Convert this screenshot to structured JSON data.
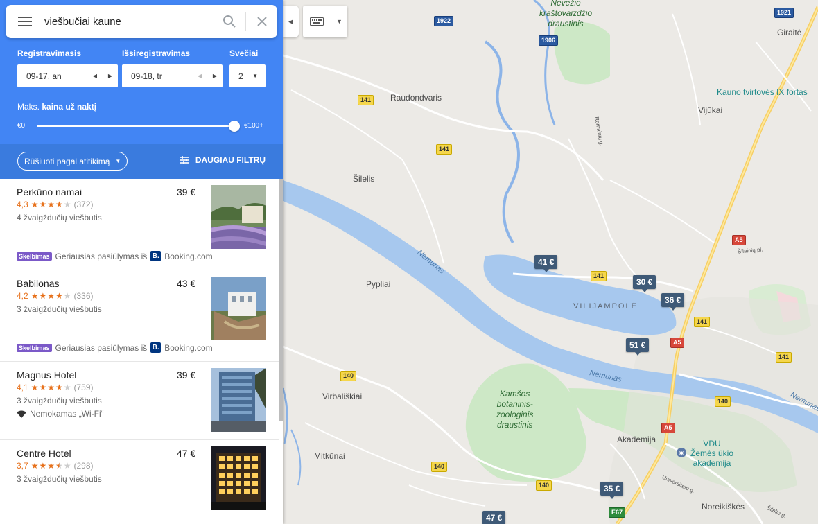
{
  "search": {
    "query": "viešbučiai kaune"
  },
  "filters": {
    "checkin_label": "Registravimasis",
    "checkin_value": "09-17, an",
    "checkout_label": "Išsiregistravimas",
    "checkout_value": "09-18, tr",
    "guests_label": "Svečiai",
    "guests_value": "2",
    "price_label_prefix": "Maks.",
    "price_label_bold": "kaina už naktį",
    "price_min": "€0",
    "price_max": "€100+",
    "price_slider_fraction": 1.0
  },
  "sort": {
    "label": "Rūšiuoti pagal atitikimą",
    "more_filters": "DAUGIAU FILTRŲ"
  },
  "hotels": [
    {
      "name": "Perkūno namai",
      "price": "39 €",
      "rating": "4,3",
      "stars": 4.3,
      "reviews": "(372)",
      "class": "4 žvaigždučių viešbutis",
      "ad": "Skelbimas",
      "ad_text": "Geriausias pasiūlymas iš",
      "ad_provider": "Booking.com",
      "booking_letter": "B."
    },
    {
      "name": "Babilonas",
      "price": "43 €",
      "rating": "4,2",
      "stars": 4.2,
      "reviews": "(336)",
      "class": "3 žvaigždučių viešbutis",
      "ad": "Skelbimas",
      "ad_text": "Geriausias pasiūlymas iš",
      "ad_provider": "Booking.com",
      "booking_letter": "B."
    },
    {
      "name": "Magnus Hotel",
      "price": "39 €",
      "rating": "4,1",
      "stars": 4.1,
      "reviews": "(759)",
      "class": "3 žvaigždučių viešbutis",
      "amenity": "Nemokamas „Wi-Fi“"
    },
    {
      "name": "Centre Hotel",
      "price": "47 €",
      "rating": "3,7",
      "stars": 3.7,
      "reviews": "(298)",
      "class": "3 žvaigždučių viešbutis"
    }
  ],
  "map": {
    "places": {
      "raudondvaris": "Raudondvaris",
      "vijukai": "Vijūkai",
      "giraite": "Giraitė",
      "kauno_fort": "Kauno tvirtovės IX fortas",
      "silelis": "Šilelis",
      "pypliai": "Pypliai",
      "vilijampole": "VILIJAMPOLĖ",
      "virbaliskiai": "Virbališkiai",
      "mitkunai": "Mitkūnai",
      "akademija": "Akademija",
      "vdu1": "VDU",
      "vdu2": "Žemės ūkio",
      "vdu3": "akademija",
      "noreikiskes": "Noreikiškės",
      "neris_top1": "Nevėžio",
      "neris_top2": "kraštovaizdžio",
      "neris_top3": "draustinis",
      "kamsos1": "Kamšos",
      "kamsos2": "botaninis-",
      "kamsos3": "zoologinis",
      "kamsos4": "draustinis",
      "nemunas": "Nemunas",
      "romainiu": "Romainių g.",
      "silainiu": "Šilainių pl.",
      "universiteto": "Universiteto g.",
      "silelio": "Šilelio g."
    },
    "price_pins": [
      "41 €",
      "30 €",
      "36 €",
      "51 €",
      "35 €",
      "47 €"
    ],
    "shields": {
      "s1922": "1922",
      "s1906": "1906",
      "s1921": "1921",
      "s141a": "141",
      "s141b": "141",
      "s141c": "141",
      "s141d": "141",
      "s141e": "141",
      "s140a": "140",
      "s140b": "140",
      "s140c": "140",
      "s140d": "140",
      "a5a": "A5",
      "a5b": "A5",
      "a5c": "A5",
      "e67": "E67"
    }
  }
}
